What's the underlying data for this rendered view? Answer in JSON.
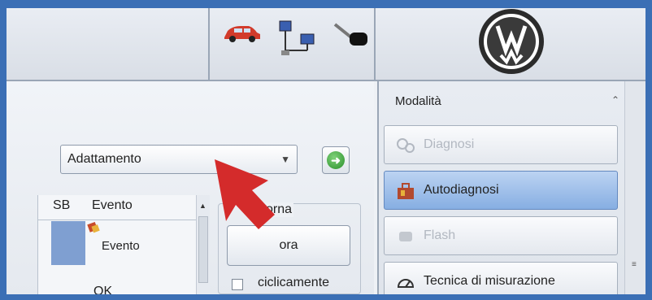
{
  "header": {
    "icons": [
      "car-icon",
      "network-icon",
      "key-icon",
      "vw-logo"
    ]
  },
  "left": {
    "dropdown_value": "Adattamento",
    "go_icon": "arrow-right-icon",
    "table": {
      "headers": [
        "SB",
        "Evento"
      ],
      "rows": [
        {
          "sb": "",
          "evento": "Evento"
        },
        {
          "sb": "",
          "evento": "OK"
        }
      ]
    },
    "group": {
      "title": "orna",
      "button_label": "ora",
      "checkbox_label": "ciclicamente"
    }
  },
  "right": {
    "title": "Modalità",
    "buttons": [
      {
        "label": "Diagnosi",
        "state": "disabled"
      },
      {
        "label": "Autodiagnosi",
        "state": "active"
      },
      {
        "label": "Flash",
        "state": "disabled"
      },
      {
        "label": "Tecnica di misurazione",
        "state": "normal"
      }
    ]
  },
  "colors": {
    "outer_border": "#3b6fb5",
    "active_button": "#86aee2",
    "arrow": "#d42b2b",
    "go_green": "#2a8f2a"
  }
}
